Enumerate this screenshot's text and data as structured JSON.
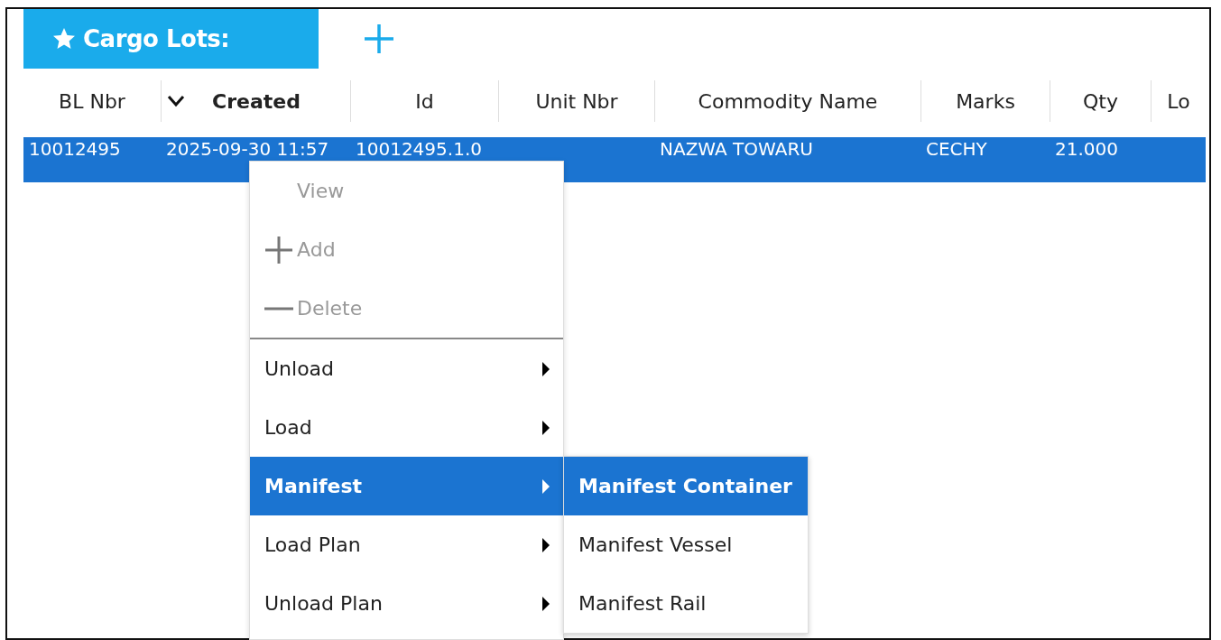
{
  "panel": {
    "title": "Cargo Lots:"
  },
  "table": {
    "columns": [
      {
        "label": "BL Nbr",
        "sorted": false
      },
      {
        "label": "Created",
        "sorted": true
      },
      {
        "label": "Id",
        "sorted": false
      },
      {
        "label": "Unit Nbr",
        "sorted": false
      },
      {
        "label": "Commodity Name",
        "sorted": false
      },
      {
        "label": "Marks",
        "sorted": false
      },
      {
        "label": "Qty",
        "sorted": false
      },
      {
        "label": "Lo",
        "sorted": false
      }
    ],
    "rows": [
      {
        "selected": true,
        "cells": [
          "10012495",
          "2025-09-30 11:57",
          "10012495.1.0",
          "",
          "NAZWA TOWARU",
          "CECHY",
          "21.000",
          ""
        ]
      }
    ]
  },
  "context_menu": {
    "items": [
      {
        "kind": "plain",
        "label": "View",
        "disabled": true,
        "selected": false
      },
      {
        "kind": "add",
        "label": "Add",
        "disabled": true,
        "selected": false
      },
      {
        "kind": "remove",
        "label": "Delete",
        "disabled": true,
        "selected": false
      },
      {
        "kind": "separator"
      },
      {
        "kind": "submenu",
        "label": "Unload",
        "disabled": false,
        "selected": false
      },
      {
        "kind": "submenu",
        "label": "Load",
        "disabled": false,
        "selected": false
      },
      {
        "kind": "submenu",
        "label": "Manifest",
        "disabled": false,
        "selected": true
      },
      {
        "kind": "submenu",
        "label": "Load Plan",
        "disabled": false,
        "selected": false
      },
      {
        "kind": "submenu",
        "label": "Unload Plan",
        "disabled": false,
        "selected": false
      }
    ],
    "submenu": {
      "items": [
        {
          "label": "Manifest Container",
          "selected": true
        },
        {
          "label": "Manifest Vessel",
          "selected": false
        },
        {
          "label": "Manifest Rail",
          "selected": false
        }
      ]
    }
  }
}
